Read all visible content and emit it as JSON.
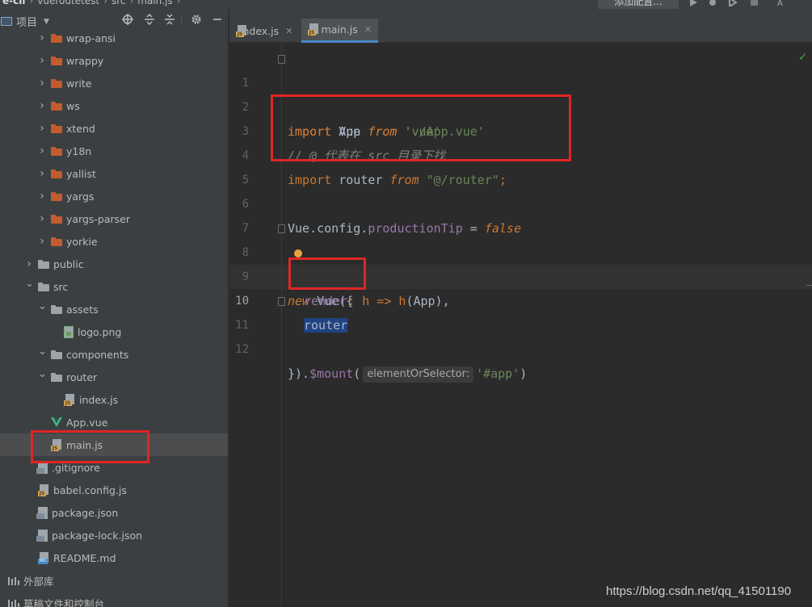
{
  "breadcrumb": {
    "root": "e-cli",
    "project": "vueroutetest",
    "folder": "src",
    "file": "main.js"
  },
  "toolbar": {
    "run_config_label": "添加配置..."
  },
  "project_panel": {
    "title": "项目",
    "items": [
      {
        "label": "wrap-ansi",
        "type": "folder-orange",
        "level": 1,
        "arrow": "right"
      },
      {
        "label": "wrappy",
        "type": "folder-orange",
        "level": 1,
        "arrow": "right"
      },
      {
        "label": "write",
        "type": "folder-orange",
        "level": 1,
        "arrow": "right"
      },
      {
        "label": "ws",
        "type": "folder-orange",
        "level": 1,
        "arrow": "right"
      },
      {
        "label": "xtend",
        "type": "folder-orange",
        "level": 1,
        "arrow": "right"
      },
      {
        "label": "y18n",
        "type": "folder-orange",
        "level": 1,
        "arrow": "right"
      },
      {
        "label": "yallist",
        "type": "folder-orange",
        "level": 1,
        "arrow": "right"
      },
      {
        "label": "yargs",
        "type": "folder-orange",
        "level": 1,
        "arrow": "right"
      },
      {
        "label": "yargs-parser",
        "type": "folder-orange",
        "level": 1,
        "arrow": "right"
      },
      {
        "label": "yorkie",
        "type": "folder-orange",
        "level": 1,
        "arrow": "right"
      },
      {
        "label": "public",
        "type": "folder-grey",
        "level": 0,
        "arrow": "right"
      },
      {
        "label": "src",
        "type": "folder-grey",
        "level": 0,
        "arrow": "down"
      },
      {
        "label": "assets",
        "type": "folder-grey",
        "level": 1,
        "arrow": "down"
      },
      {
        "label": "logo.png",
        "type": "file-img",
        "level": 2,
        "arrow": ""
      },
      {
        "label": "components",
        "type": "folder-grey",
        "level": 1,
        "arrow": "down"
      },
      {
        "label": "router",
        "type": "folder-grey",
        "level": 1,
        "arrow": "down"
      },
      {
        "label": "index.js",
        "type": "file-js",
        "level": 2,
        "arrow": ""
      },
      {
        "label": "App.vue",
        "type": "file-vue",
        "level": 1,
        "arrow": ""
      },
      {
        "label": "main.js",
        "type": "file-js",
        "level": 1,
        "arrow": "",
        "selected": true
      },
      {
        "label": ".gitignore",
        "type": "file-gen",
        "level": 0,
        "arrow": ""
      },
      {
        "label": "babel.config.js",
        "type": "file-js",
        "level": 0,
        "arrow": ""
      },
      {
        "label": "package.json",
        "type": "file-gen",
        "level": 0,
        "arrow": ""
      },
      {
        "label": "package-lock.json",
        "type": "file-gen",
        "level": 0,
        "arrow": ""
      },
      {
        "label": "README.md",
        "type": "file-md",
        "level": 0,
        "arrow": ""
      }
    ],
    "external_libs": "外部库",
    "scratches": "草稿文件和控制台"
  },
  "tabs": [
    {
      "label": "index.js",
      "active": false
    },
    {
      "label": "main.js",
      "active": true
    }
  ],
  "editor": {
    "line_numbers": [
      "1",
      "2",
      "3",
      "4",
      "5",
      "6",
      "7",
      "8",
      "9",
      "10",
      "11",
      "12"
    ],
    "current_line": "10",
    "code": {
      "l1": {
        "kw": "import",
        "name": " Vue ",
        "from": "from",
        "str": " 'vue'"
      },
      "l2": {
        "kw": "import",
        "name": " App ",
        "from": "from",
        "str": " './App.vue'"
      },
      "l3": {
        "comment": "// @ 代表在 src 目录下找"
      },
      "l4": {
        "kw": "import",
        "name": " router ",
        "from": "from",
        "str": " \"@/router\"",
        "end": ";"
      },
      "l6": {
        "obj": "Vue.config.",
        "prop": "productionTip",
        "op": " = ",
        "val": "false"
      },
      "l8": {
        "kw": "new",
        "cls": " Vue({"
      },
      "l9": {
        "prop": "render",
        "colon": ": ",
        "param": "h",
        "arrow": " => ",
        "fn": "h",
        "args": "(App),"
      },
      "l10": {
        "word": "router"
      },
      "l11": {
        "start": "}).",
        "method": "$mount",
        "paren": "(",
        "hint": "elementOrSelector:",
        "str": "'#app'",
        "end": ")"
      }
    }
  },
  "watermark": "https://blog.csdn.net/qq_41501190",
  "colors": {
    "highlight_box": "#e02525",
    "keyword": "#cc7832",
    "string": "#6a8759",
    "selection": "#214283"
  }
}
